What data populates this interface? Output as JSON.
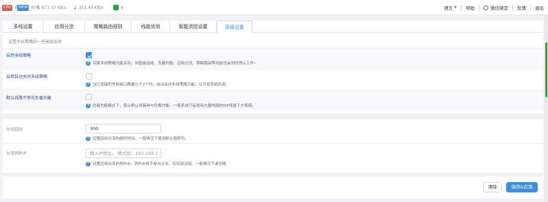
{
  "topbar": {
    "cpu": {
      "value": "8%",
      "color": "#e0594b"
    },
    "mem": {
      "badge": "MEM",
      "value": "65%",
      "color": "#3b8ede"
    },
    "upload": "673.53 KB/s",
    "download": "352.49 KB/s",
    "online": {
      "value": "4",
      "color": "#27a744"
    },
    "right": {
      "lang": "语言",
      "help": "帮助",
      "wechat": "微信绑定",
      "feedback": "反馈",
      "logout": "退出"
    }
  },
  "tabs": [
    {
      "label": "多线设置"
    },
    {
      "label": "应用分流"
    },
    {
      "label": "策略路由规则"
    },
    {
      "label": "线路侦测"
    },
    {
      "label": "智能流控设置"
    },
    {
      "label": "高级设置"
    }
  ],
  "subtitle": "设置多线策略的一些高级选项",
  "rows": {
    "enable_policy": {
      "label": "启用多线策略",
      "checked": true,
      "hint": "如果多线策略功能关闭，则智能选线、负载均衡、应用分流、策略路由等功能也会同时停止工作!"
    },
    "auto_close": {
      "label": "启用自动关闭多线策略",
      "checked": false,
      "hint": "当已连接的外网接口数量小于2个时，自动关闭多线策略功能，以节省系统资源。"
    },
    "default_route": {
      "label": "默认线路不参与负载均衡",
      "checked": false,
      "hint": "负载均衡模式下，禁止默认线路参与负载均衡。一般来说只有使用大量线路的ISP场景下才使用。"
    }
  },
  "timeout": {
    "label": "分流超时",
    "value": "300",
    "hint": "设置应用分流的超时时间。一般情况下使用默认值即可。"
  },
  "exclude_ip": {
    "label": "分流例外IP",
    "placeholder": "填入IP地址。 格式如：192.168.1.2",
    "hint": "设置应用分流的例外IP，例外IP将不参与分流。仅仅调试用。一般情况下请忽略"
  },
  "buttons": {
    "clear": "清除",
    "save": "保存&应用"
  }
}
